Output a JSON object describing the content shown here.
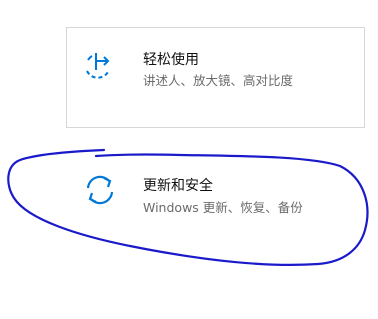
{
  "settings_tiles": [
    {
      "title": "轻松使用",
      "description": "讲述人、放大镜、高对比度",
      "icon": "ease-of-access-icon"
    },
    {
      "title": "更新和安全",
      "description": "Windows 更新、恢复、备份",
      "icon": "sync-update-icon"
    }
  ],
  "colors": {
    "accent": "#0078d7",
    "annotation": "#1a1acb",
    "tile_border": "#d7d7d7",
    "title_text": "#111111",
    "description_text": "#6b6b6b"
  }
}
